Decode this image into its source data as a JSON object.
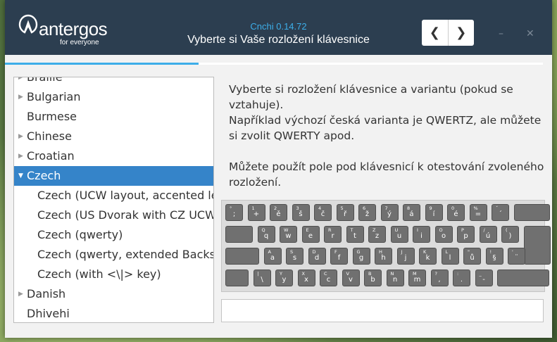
{
  "app": {
    "logo_text": "antergos",
    "tagline": "for everyone",
    "version": "Cnchi  0.14.72",
    "page_title": "Vyberte si Vaše rozložení klávesnice"
  },
  "nav": {
    "back": "❮",
    "forward": "❯"
  },
  "window_controls": {
    "minimize": "–",
    "close": "✕"
  },
  "progress": {
    "fraction": 0.36
  },
  "layouts": [
    {
      "label": "Braille",
      "arrow": "▶",
      "indent": 0
    },
    {
      "label": "Bulgarian",
      "arrow": "▶",
      "indent": 0
    },
    {
      "label": "Burmese",
      "arrow": "",
      "indent": 0
    },
    {
      "label": "Chinese",
      "arrow": "▶",
      "indent": 0
    },
    {
      "label": "Croatian",
      "arrow": "▶",
      "indent": 0
    },
    {
      "label": "Czech",
      "arrow": "▼",
      "indent": 0,
      "selected": true
    },
    {
      "label": "Czech (UCW layout, accented letters only)",
      "arrow": "",
      "indent": 1
    },
    {
      "label": "Czech (US Dvorak with CZ UCW support)",
      "arrow": "",
      "indent": 1
    },
    {
      "label": "Czech (qwerty)",
      "arrow": "",
      "indent": 1
    },
    {
      "label": "Czech (qwerty, extended Backslash)",
      "arrow": "",
      "indent": 1
    },
    {
      "label": "Czech (with <\\|> key)",
      "arrow": "",
      "indent": 1
    },
    {
      "label": "Danish",
      "arrow": "▶",
      "indent": 0
    },
    {
      "label": "Dhivehi",
      "arrow": "",
      "indent": 0
    }
  ],
  "description": {
    "line1": "Vyberte si rozložení klávesnice a variantu (pokud se vztahuje).",
    "line2": "Například výchozí česká varianta je QWERTZ, ale můžete si zvolit QWERTY apod.",
    "line3": "Můžete použít pole pod klávesnicí k otestování zvoleného rozložení."
  },
  "keyboard": {
    "row1": [
      {
        "top": "°",
        "main": ";"
      },
      {
        "top": "1",
        "main": "+"
      },
      {
        "top": "2",
        "main": "ě"
      },
      {
        "top": "3",
        "main": "š"
      },
      {
        "top": "4",
        "main": "č"
      },
      {
        "top": "5",
        "main": "ř"
      },
      {
        "top": "6",
        "main": "ž"
      },
      {
        "top": "7",
        "main": "ý"
      },
      {
        "top": "8",
        "main": "á"
      },
      {
        "top": "9",
        "main": "í"
      },
      {
        "top": "0",
        "main": "é"
      },
      {
        "top": "%",
        "main": "="
      },
      {
        "top": "ˇ",
        "main": "´"
      },
      {
        "top": "",
        "main": ""
      }
    ],
    "row2": [
      {
        "top": "",
        "main": ""
      },
      {
        "top": "Q",
        "main": "q"
      },
      {
        "top": "W",
        "main": "w"
      },
      {
        "top": "E",
        "main": "e"
      },
      {
        "top": "R",
        "main": "r"
      },
      {
        "top": "T",
        "main": "t"
      },
      {
        "top": "Z",
        "main": "z"
      },
      {
        "top": "U",
        "main": "u"
      },
      {
        "top": "I",
        "main": "i"
      },
      {
        "top": "O",
        "main": "o"
      },
      {
        "top": "P",
        "main": "p"
      },
      {
        "top": "/",
        "main": "ú"
      },
      {
        "top": "(",
        "main": ")"
      },
      {
        "top": "",
        "main": ""
      }
    ],
    "row3": [
      {
        "top": "",
        "main": ""
      },
      {
        "top": "A",
        "main": "a"
      },
      {
        "top": "S",
        "main": "s"
      },
      {
        "top": "D",
        "main": "d"
      },
      {
        "top": "F",
        "main": "f"
      },
      {
        "top": "G",
        "main": "g"
      },
      {
        "top": "H",
        "main": "h"
      },
      {
        "top": "J",
        "main": "j"
      },
      {
        "top": "K",
        "main": "k"
      },
      {
        "top": "L",
        "main": "l"
      },
      {
        "top": "\"",
        "main": "ů"
      },
      {
        "top": "!",
        "main": "§"
      },
      {
        "top": "'",
        "main": "¨"
      }
    ],
    "row4": [
      {
        "top": "",
        "main": ""
      },
      {
        "top": "|",
        "main": "\\"
      },
      {
        "top": "Y",
        "main": "y"
      },
      {
        "top": "X",
        "main": "x"
      },
      {
        "top": "C",
        "main": "c"
      },
      {
        "top": "V",
        "main": "v"
      },
      {
        "top": "B",
        "main": "b"
      },
      {
        "top": "N",
        "main": "n"
      },
      {
        "top": "M",
        "main": "m"
      },
      {
        "top": "?",
        "main": ","
      },
      {
        "top": ":",
        "main": "."
      },
      {
        "top": "_",
        "main": "-"
      },
      {
        "top": "",
        "main": ""
      }
    ]
  },
  "test_field": {
    "value": ""
  }
}
